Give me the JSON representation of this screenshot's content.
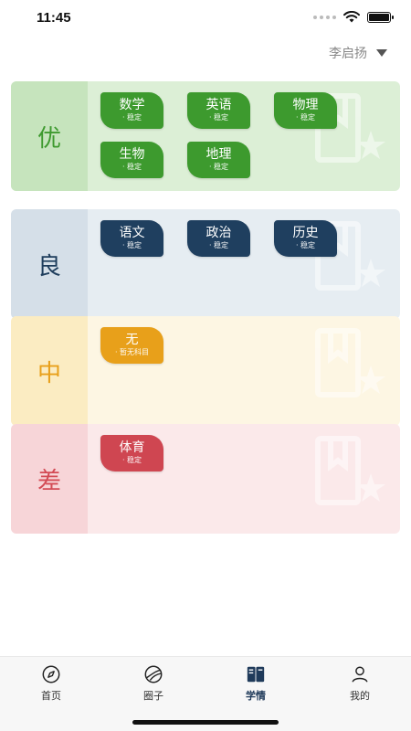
{
  "status": {
    "time": "11:45"
  },
  "header": {
    "user_name": "李启扬"
  },
  "grades": [
    {
      "label": "优",
      "bg": "#dcefd6",
      "col_bg": "#c6e4bd",
      "label_color": "#3e9a2f",
      "chip_color": "#3d9a2e",
      "subjects": [
        {
          "name": "数学",
          "status": "· 稳定"
        },
        {
          "name": "英语",
          "status": "· 稳定"
        },
        {
          "name": "物理",
          "status": "· 稳定"
        },
        {
          "name": "生物",
          "status": "· 稳定"
        },
        {
          "name": "地理",
          "status": "· 稳定"
        }
      ]
    },
    {
      "label": "良",
      "bg": "#e6edf2",
      "col_bg": "#d5dfe8",
      "label_color": "#1e3d5c",
      "chip_color": "#1f3f5f",
      "subjects": [
        {
          "name": "语文",
          "status": "· 稳定"
        },
        {
          "name": "政治",
          "status": "· 稳定"
        },
        {
          "name": "历史",
          "status": "· 稳定"
        }
      ]
    },
    {
      "label": "中",
      "bg": "#fdf6e3",
      "col_bg": "#fbecc2",
      "label_color": "#e8a01a",
      "chip_color": "#e8a01a",
      "subjects": [
        {
          "name": "无",
          "status": "· 暂无科目"
        }
      ]
    },
    {
      "label": "差",
      "bg": "#fbe9ea",
      "col_bg": "#f7d5d8",
      "label_color": "#d34b55",
      "chip_color": "#cf4651",
      "subjects": [
        {
          "name": "体育",
          "status": "· 稳定"
        }
      ]
    }
  ],
  "tabs": [
    {
      "label": "首页",
      "icon": "compass-icon"
    },
    {
      "label": "圈子",
      "icon": "circle-icon"
    },
    {
      "label": "学情",
      "icon": "book-icon"
    },
    {
      "label": "我的",
      "icon": "user-icon"
    }
  ]
}
